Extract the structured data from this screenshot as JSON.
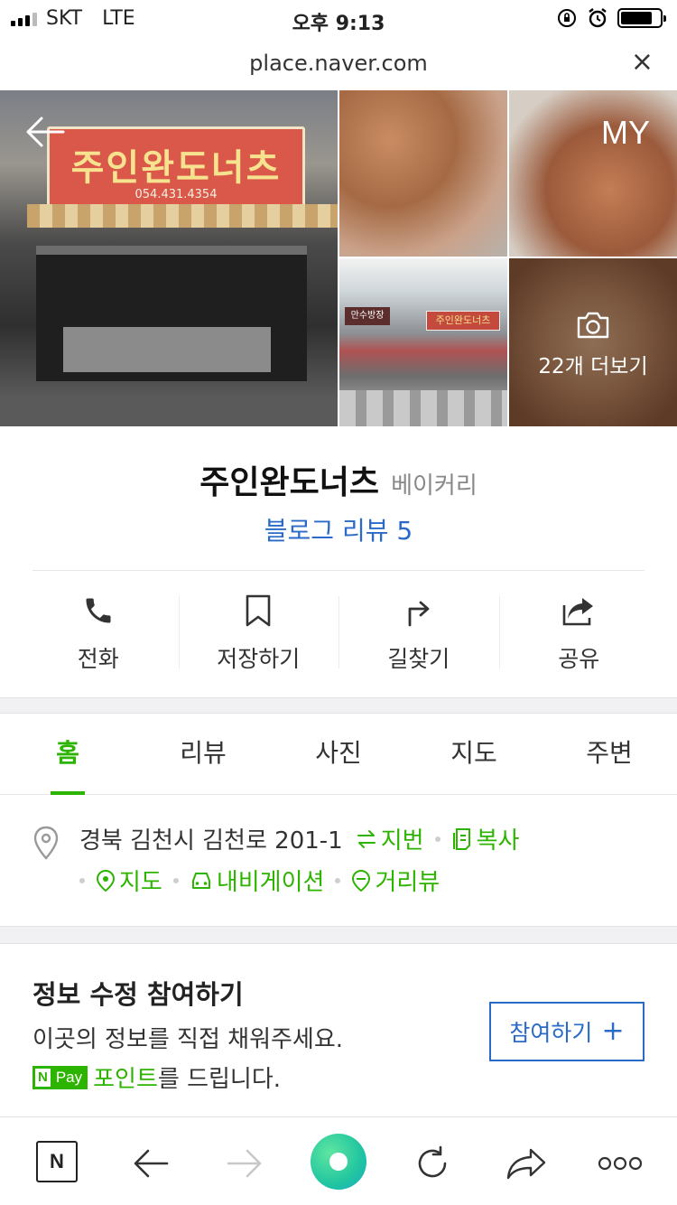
{
  "status_bar": {
    "carrier": "SKT",
    "network": "LTE",
    "time": "오후 9:13",
    "battery_level": 0.8
  },
  "url_bar": {
    "url": "place.naver.com",
    "close_symbol": "×"
  },
  "photos": {
    "my_label": "MY",
    "more_label": "22개 더보기",
    "sign_text": "주인완도너츠",
    "sign_phone": "054.431.4354",
    "thumb_sign_text": "주인완도너츠",
    "thumb_sign2_text": "만수방장"
  },
  "place": {
    "name": "주인완도너츠",
    "category": "베이커리",
    "blog_review": "블로그 리뷰 5"
  },
  "actions": [
    {
      "label": "전화",
      "icon": "phone-icon"
    },
    {
      "label": "저장하기",
      "icon": "bookmark-icon"
    },
    {
      "label": "길찾기",
      "icon": "directions-icon"
    },
    {
      "label": "공유",
      "icon": "share-icon"
    }
  ],
  "tabs": [
    {
      "label": "홈",
      "active": true
    },
    {
      "label": "리뷰",
      "active": false
    },
    {
      "label": "사진",
      "active": false
    },
    {
      "label": "지도",
      "active": false
    },
    {
      "label": "주변",
      "active": false
    }
  ],
  "address": {
    "text": "경북 김천시 김천로 201-1",
    "jibun": "지번",
    "copy": "복사",
    "map": "지도",
    "navigation": "내비게이션",
    "street_view": "거리뷰"
  },
  "participate": {
    "title": "정보 수정 참여하기",
    "description": "이곳의 정보를 직접 채워주세요.",
    "npay_n": "N",
    "npay_label": "Pay",
    "point_text": "포인트",
    "point_suffix": "를 드립니다.",
    "button_label": "참여하기",
    "button_plus": "+"
  },
  "toolbar": {
    "n_label": "N"
  },
  "colors": {
    "accent_green": "#2db400",
    "link_blue": "#2a6ac8"
  }
}
